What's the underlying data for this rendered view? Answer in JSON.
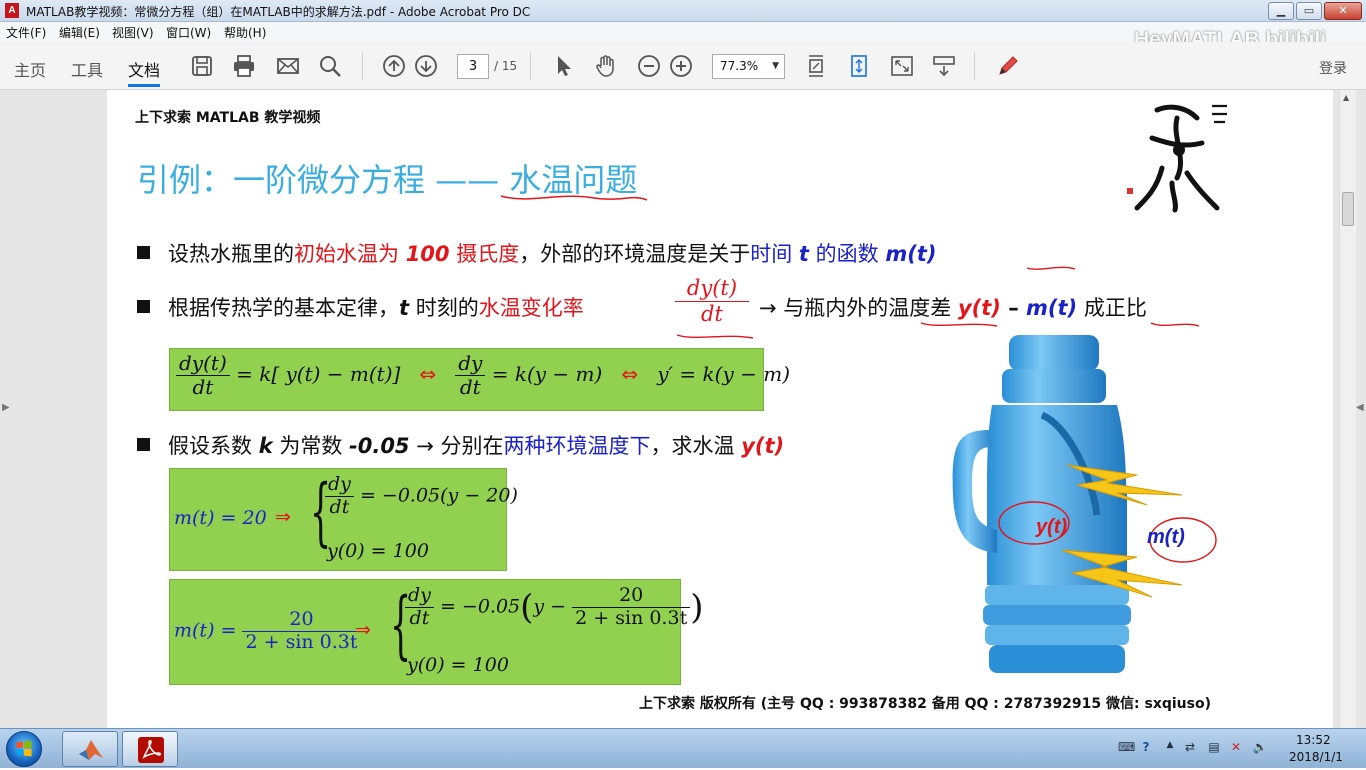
{
  "window": {
    "title": "MATLAB教学视频：常微分方程（组）在MATLAB中的求解方法.pdf - Adobe Acrobat Pro DC",
    "logo_text": "A",
    "minimize": "▁",
    "maximize": "▭",
    "close": "✕"
  },
  "menu": {
    "items": [
      "文件(F)",
      "编辑(E)",
      "视图(V)",
      "窗口(W)",
      "帮助(H)"
    ],
    "watermark": "HeyMATLAB bilibili"
  },
  "toolbar": {
    "tabs": [
      "主页",
      "工具",
      "文档"
    ],
    "page_current": "3",
    "page_total": "/ 15",
    "zoom": "77.3%",
    "login": "登录"
  },
  "slide": {
    "header": "上下求索 MATLAB 教学视频",
    "title": "引例：一阶微分方程 —— 水温问题",
    "bullet1": {
      "a": "设热水瓶里的",
      "b": "初始水温为",
      "c": "100",
      "d": "摄氏度",
      "e": "，外部的环境温度是关于",
      "f": "时间",
      "g": "t",
      "h": "的函数",
      "i": "m(t)"
    },
    "bullet2": {
      "a": "根据传热学的基本定律，",
      "b": "t",
      "c": " 时刻的",
      "d": "水温变化率",
      "frac_num": "dy(t)",
      "frac_den": "dt",
      "e": "→  与瓶内外的温度差 ",
      "f": "y(t)",
      "g": " – ",
      "h": "m(t)",
      "i": " 成正比"
    },
    "eq1": {
      "n1": "dy(t)",
      "d1": "dt",
      "r1": "= k[ y(t) − m(t)]",
      "arrow": "⇔",
      "n2": "dy",
      "d2": "dt",
      "r2": "= k(y − m)",
      "r3": "y′ = k(y − m)"
    },
    "bullet3": {
      "a": "假设系数 ",
      "b": "k",
      "c": " 为常数 ",
      "d": "-0.05",
      "e": " →  分别在",
      "f": "两种环境温度下",
      "g": "，求水温 ",
      "h": "y(t)"
    },
    "eq2": {
      "lhs": "m(t) = 20",
      "implies": "⇒",
      "n": "dy",
      "d": "dt",
      "r": "= −0.05(y − 20)",
      "init": "y(0) = 100"
    },
    "eq3": {
      "lhs_a": "m(t) =",
      "lhs_n": "20",
      "lhs_d": "2 + sin 0.3t",
      "implies": "⇒",
      "n": "dy",
      "d": "dt",
      "r_a": "= −0.05",
      "r_b": "y −",
      "r_n": "20",
      "r_d": "2 + sin 0.3t",
      "init": "y(0) = 100"
    },
    "image_labels": {
      "y": "y(t)",
      "m": "m(t)"
    },
    "footer": "上下求索  版权所有  (主号 QQ : 993878382   备用 QQ : 2787392915   微信: sxqiuso)"
  },
  "taskbar": {
    "time": "13:52",
    "date": "2018/1/1"
  },
  "colors": {
    "title_blue": "#3aaee0",
    "emphasis_red": "#e3141a",
    "emphasis_blue": "#1a22c8",
    "equation_green": "#92d050"
  }
}
